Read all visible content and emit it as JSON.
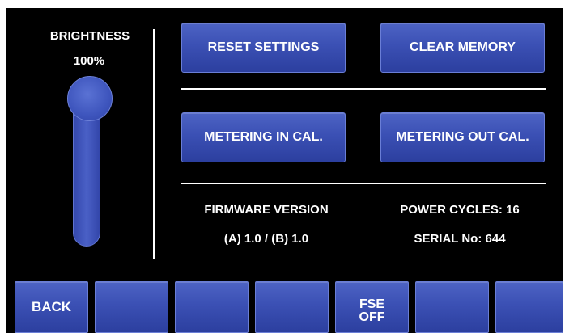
{
  "brightness": {
    "title": "BRIGHTNESS",
    "value_label": "100%",
    "level": 1.0
  },
  "buttons": {
    "reset_settings": "RESET SETTINGS",
    "clear_memory": "CLEAR MEMORY",
    "metering_in_cal": "METERING IN CAL.",
    "metering_out_cal": "METERING OUT CAL."
  },
  "info": {
    "firmware_label": "FIRMWARE VERSION",
    "firmware_value": "(A) 1.0 / (B) 1.0",
    "power_cycles": "POWER CYCLES: 16",
    "serial": "SERIAL No: 644"
  },
  "bottom_bar": {
    "back": "BACK",
    "fse_line1": "FSE",
    "fse_line2": "OFF"
  },
  "colors": {
    "button_blue": "#3b50b4",
    "background": "#000000",
    "text": "#ffffff"
  }
}
